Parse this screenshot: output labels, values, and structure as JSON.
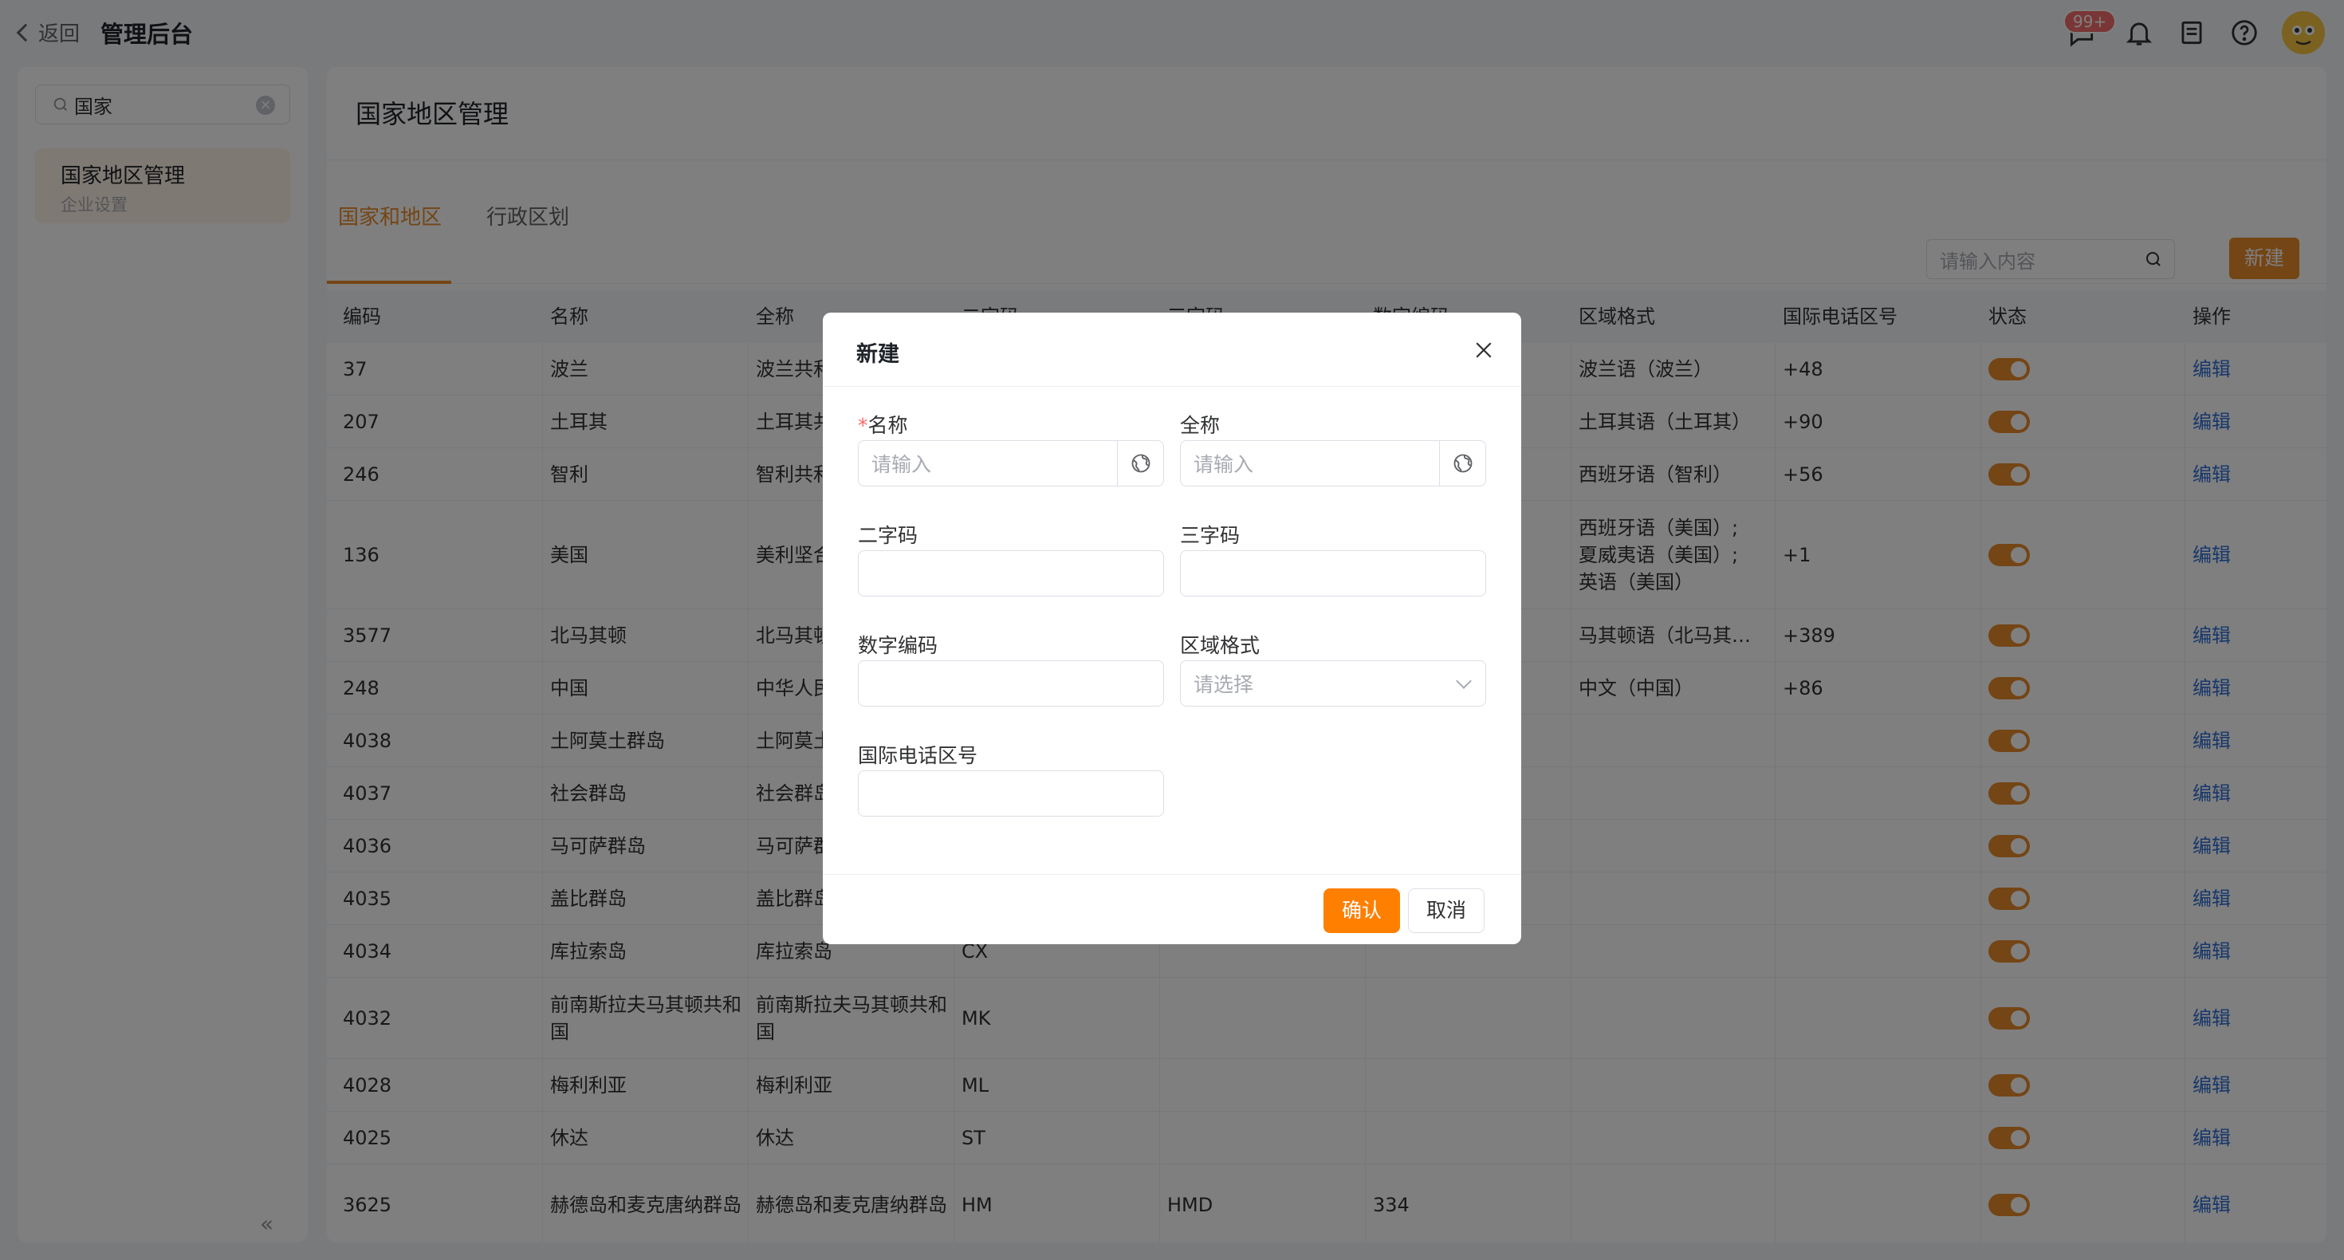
{
  "header": {
    "back_label": "返回",
    "brand": "管理后台",
    "badge_count": "99+"
  },
  "sidebar": {
    "search_value": "国家",
    "item": {
      "title": "国家地区管理",
      "subtitle": "企业设置"
    }
  },
  "main": {
    "title": "国家地区管理",
    "tabs": [
      {
        "label": "国家和地区",
        "active": true
      },
      {
        "label": "行政区划",
        "active": false
      }
    ],
    "search_placeholder": "请输入内容",
    "new_button": "新建"
  },
  "table": {
    "columns": [
      "编码",
      "名称",
      "全称",
      "二字码",
      "三字码",
      "数字编码",
      "区域格式",
      "国际电话区号",
      "状态",
      "操作"
    ],
    "rows": [
      {
        "code": "37",
        "name": "波兰",
        "full": "波兰共和国",
        "two": "",
        "three": "",
        "num": "",
        "format": "波兰语（波兰）",
        "phone": "+48",
        "action": "编辑"
      },
      {
        "code": "207",
        "name": "土耳其",
        "full": "土耳其共和国",
        "two": "",
        "three": "",
        "num": "",
        "format": "土耳其语（土耳其）",
        "phone": "+90",
        "action": "编辑"
      },
      {
        "code": "246",
        "name": "智利",
        "full": "智利共和国",
        "two": "",
        "three": "",
        "num": "",
        "format": "西班牙语（智利）",
        "phone": "+56",
        "action": "编辑"
      },
      {
        "code": "136",
        "name": "美国",
        "full": "美利坚合众国",
        "two": "",
        "three": "",
        "num": "",
        "format": "西班牙语（美国）;夏威夷语（美国）;英语（美国）",
        "phone": "+1",
        "action": "编辑"
      },
      {
        "code": "3577",
        "name": "北马其顿",
        "full": "北马其顿共和国",
        "two": "",
        "three": "",
        "num": "",
        "format": "马其顿语（北马其…",
        "phone": "+389",
        "action": "编辑"
      },
      {
        "code": "248",
        "name": "中国",
        "full": "中华人民共和国",
        "two": "",
        "three": "",
        "num": "",
        "format": "中文（中国）",
        "phone": "+86",
        "action": "编辑"
      },
      {
        "code": "4038",
        "name": "土阿莫土群岛",
        "full": "土阿莫土群岛",
        "two": "",
        "three": "",
        "num": "",
        "format": "",
        "phone": "",
        "action": "编辑"
      },
      {
        "code": "4037",
        "name": "社会群岛",
        "full": "社会群岛",
        "two": "",
        "three": "",
        "num": "",
        "format": "",
        "phone": "",
        "action": "编辑"
      },
      {
        "code": "4036",
        "name": "马可萨群岛",
        "full": "马可萨群岛",
        "two": "",
        "three": "",
        "num": "",
        "format": "",
        "phone": "",
        "action": "编辑"
      },
      {
        "code": "4035",
        "name": "盖比群岛",
        "full": "盖比群岛",
        "two": "",
        "three": "",
        "num": "",
        "format": "",
        "phone": "",
        "action": "编辑"
      },
      {
        "code": "4034",
        "name": "库拉索岛",
        "full": "库拉索岛",
        "two": "CX",
        "three": "",
        "num": "",
        "format": "",
        "phone": "",
        "action": "编辑"
      },
      {
        "code": "4032",
        "name": "前南斯拉夫马其顿共和国",
        "full": "前南斯拉夫马其顿共和国",
        "two": "MK",
        "three": "",
        "num": "",
        "format": "",
        "phone": "",
        "action": "编辑"
      },
      {
        "code": "4028",
        "name": "梅利利亚",
        "full": "梅利利亚",
        "two": "ML",
        "three": "",
        "num": "",
        "format": "",
        "phone": "",
        "action": "编辑"
      },
      {
        "code": "4025",
        "name": "休达",
        "full": "休达",
        "two": "ST",
        "three": "",
        "num": "",
        "format": "",
        "phone": "",
        "action": "编辑"
      },
      {
        "code": "3625",
        "name": "赫德岛和麦克唐纳群岛",
        "full": "赫德岛和麦克唐纳群岛",
        "two": "HM",
        "three": "HMD",
        "num": "334",
        "format": "",
        "phone": "",
        "action": "编辑"
      }
    ]
  },
  "dialog": {
    "title": "新建",
    "fields": {
      "name": {
        "label": "名称",
        "placeholder": "请输入"
      },
      "fullname": {
        "label": "全称",
        "placeholder": "请输入"
      },
      "two_code": {
        "label": "二字码"
      },
      "three_code": {
        "label": "三字码"
      },
      "num_code": {
        "label": "数字编码"
      },
      "region_format": {
        "label": "区域格式",
        "placeholder": "请选择"
      },
      "phone_code": {
        "label": "国际电话区号"
      }
    },
    "confirm": "确认",
    "cancel": "取消"
  },
  "colors": {
    "accent": "#e98a2b",
    "confirm": "#ff7f00",
    "link": "#2f6fd6",
    "badge": "#f56c6c"
  }
}
